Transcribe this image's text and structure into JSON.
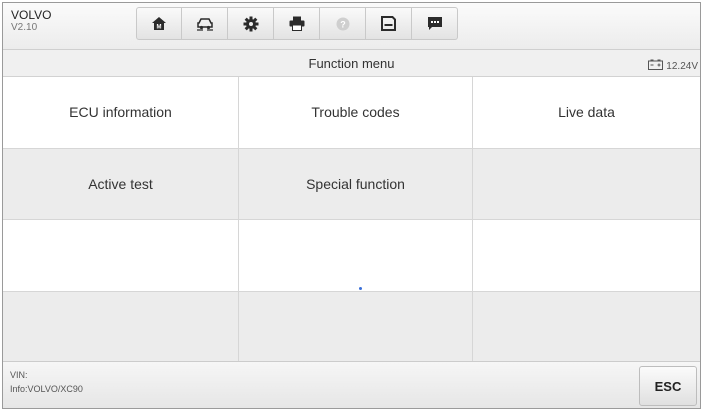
{
  "app": {
    "name": "VOLVO",
    "version": "V2.10"
  },
  "toolbar": {
    "buttons": [
      {
        "icon": "home-icon"
      },
      {
        "icon": "vehicle-swap-icon"
      },
      {
        "icon": "settings-gear-icon"
      },
      {
        "icon": "print-icon"
      },
      {
        "icon": "help-icon",
        "disabled": true
      },
      {
        "icon": "save-icon"
      },
      {
        "icon": "data-logging-icon"
      }
    ]
  },
  "header": {
    "title": "Function menu",
    "battery_voltage": "12.24V"
  },
  "menu": {
    "items": [
      "ECU information",
      "Trouble codes",
      "Live data",
      "Active test",
      "Special function"
    ]
  },
  "footer": {
    "vin": "VIN:",
    "info": "Info:VOLVO/XC90",
    "esc_label": "ESC"
  },
  "colors": {
    "accent": "#3a6fd8",
    "row_alt": "#ececec",
    "border": "#d6d6d6"
  }
}
